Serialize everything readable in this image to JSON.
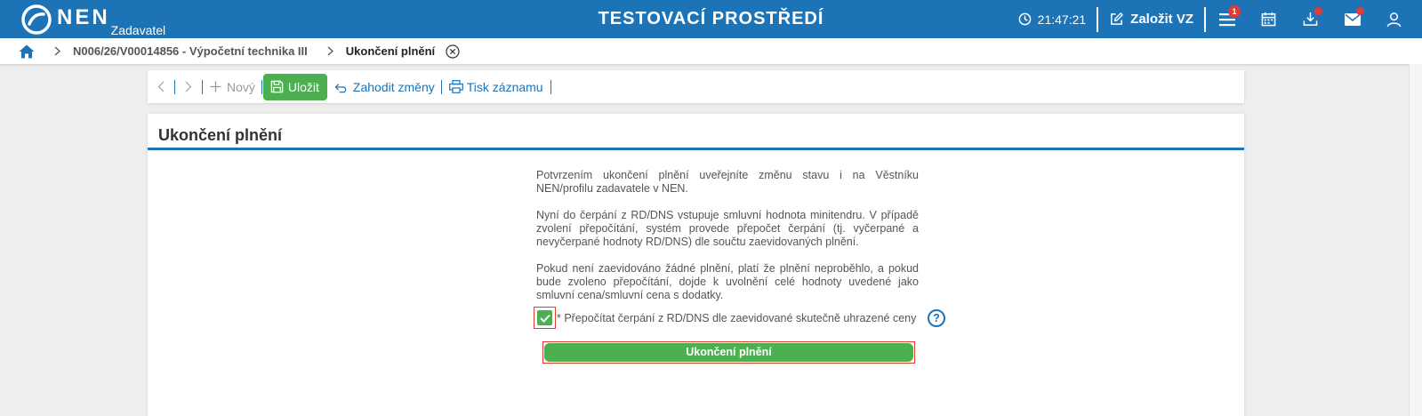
{
  "header": {
    "logo_text": "NEN",
    "logo_sub": "Zadavatel",
    "env_title": "TESTOVACÍ PROSTŘEDÍ",
    "clock": "21:47:21",
    "create_label": "Založit VZ",
    "menu_badge": "1",
    "icons": [
      "clock-icon",
      "edit-icon",
      "menu-icon",
      "calendar-icon",
      "download-icon",
      "mail-icon",
      "user-icon"
    ],
    "accent_color": "#1c73b5",
    "badge_color": "#e53935"
  },
  "breadcrumb": {
    "items": [
      "N006/26/V00014856 - Výpočetní technika III"
    ],
    "current": "Ukončení plnění"
  },
  "toolbar": {
    "new_label": "Nový",
    "save_label": "Uložit",
    "discard_label": "Zahodit změny",
    "print_label": "Tisk záznamu"
  },
  "panel": {
    "title": "Ukončení plnění",
    "paragraphs": [
      "Potvrzením ukončení plnění uveřejníte změnu stavu i na Věstníku NEN/profilu zadavatele v NEN.",
      "Nyní do čerpání z RD/DNS vstupuje smluvní hodnota minitendru. V případě zvolení přepočítání, systém provede přepočet čerpání (tj. vyčerpané a nevyčerpané hodnoty RD/DNS) dle součtu zaevidovaných plnění.",
      "Pokud není zaevidováno žádné plnění, platí že plnění neproběhlo, a pokud bude zvoleno přepočítání, dojde k uvolnění celé hodnoty uvedené jako smluvní cena/smluvní cena s dodatky."
    ],
    "checkbox_label": "* Přepočítat čerpání z RD/DNS dle zaevidované skutečně uhrazené ceny",
    "checkbox_checked": true,
    "help_symbol": "?",
    "finish_button": "Ukončení plnění",
    "success_color": "#4caf50"
  }
}
